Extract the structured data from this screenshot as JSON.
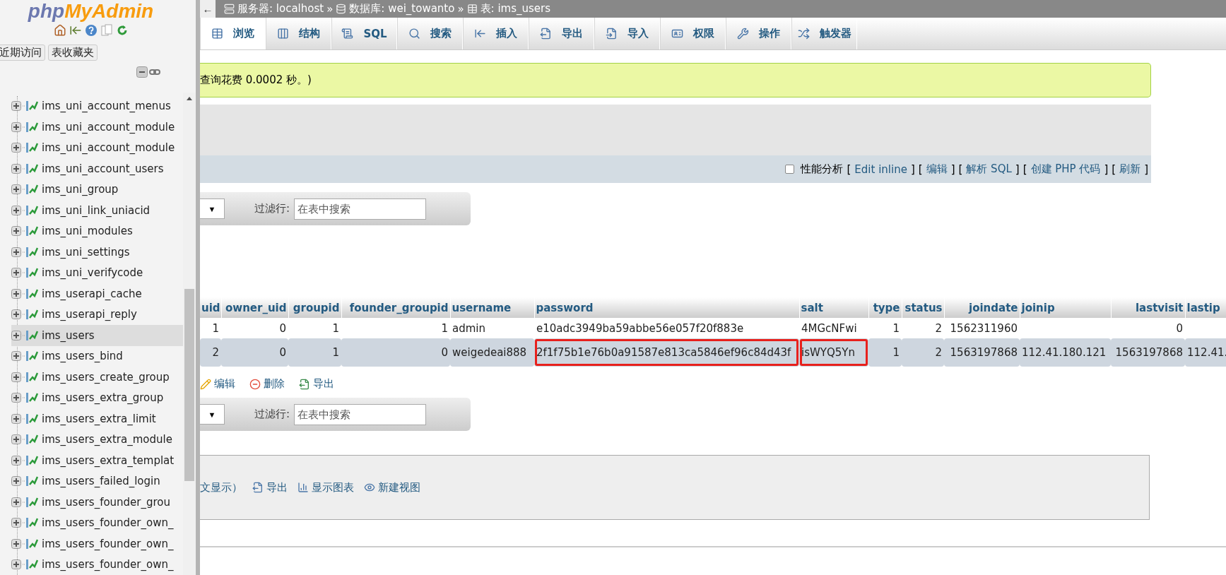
{
  "sidebar": {
    "logo": {
      "php": "php",
      "myadmin": "MyAdmin"
    },
    "buttons": [
      {
        "label": "近期访问"
      },
      {
        "label": "表收藏夹"
      }
    ],
    "tree": [
      {
        "label": "ims_uni_account_menus",
        "selected": false
      },
      {
        "label": "ims_uni_account_module",
        "selected": false
      },
      {
        "label": "ims_uni_account_module",
        "selected": false
      },
      {
        "label": "ims_uni_account_users",
        "selected": false
      },
      {
        "label": "ims_uni_group",
        "selected": false
      },
      {
        "label": "ims_uni_link_uniacid",
        "selected": false
      },
      {
        "label": "ims_uni_modules",
        "selected": false
      },
      {
        "label": "ims_uni_settings",
        "selected": false
      },
      {
        "label": "ims_uni_verifycode",
        "selected": false
      },
      {
        "label": "ims_userapi_cache",
        "selected": false
      },
      {
        "label": "ims_userapi_reply",
        "selected": false
      },
      {
        "label": "ims_users",
        "selected": true
      },
      {
        "label": "ims_users_bind",
        "selected": false
      },
      {
        "label": "ims_users_create_group",
        "selected": false
      },
      {
        "label": "ims_users_extra_group",
        "selected": false
      },
      {
        "label": "ims_users_extra_limit",
        "selected": false
      },
      {
        "label": "ims_users_extra_module",
        "selected": false
      },
      {
        "label": "ims_users_extra_templat",
        "selected": false
      },
      {
        "label": "ims_users_failed_login",
        "selected": false
      },
      {
        "label": "ims_users_founder_grou",
        "selected": false
      },
      {
        "label": "ims_users_founder_own_",
        "selected": false
      },
      {
        "label": "ims_users_founder_own_",
        "selected": false
      },
      {
        "label": "ims_users_founder_own_",
        "selected": false
      }
    ]
  },
  "breadcrumb": {
    "back": "←",
    "items": [
      {
        "label": "服务器: localhost",
        "separator": "»"
      },
      {
        "label": "数据库: wei_towanto",
        "separator": "»"
      },
      {
        "label": "表: ims_users"
      }
    ]
  },
  "tabs": [
    {
      "label": "浏览",
      "selected": true
    },
    {
      "label": "结构",
      "selected": false
    },
    {
      "label": "SQL",
      "selected": false
    },
    {
      "label": "搜索",
      "selected": false
    },
    {
      "label": "插入",
      "selected": false
    },
    {
      "label": "导出",
      "selected": false
    },
    {
      "label": "导入",
      "selected": false
    },
    {
      "label": "权限",
      "selected": false
    },
    {
      "label": "操作",
      "selected": false
    },
    {
      "label": "触发器",
      "selected": false
    }
  ],
  "notice": {
    "text": "查询花费 0.0002 秒。)"
  },
  "options_bar": {
    "profiling": {
      "label": "性能分析",
      "checked": false
    },
    "parts": [
      {
        "kind": "bracket",
        "text": "["
      },
      {
        "kind": "link",
        "text": "Edit inline"
      },
      {
        "kind": "bracket",
        "text": "]"
      },
      {
        "kind": "bracket",
        "text": "["
      },
      {
        "kind": "link",
        "text": "编辑"
      },
      {
        "kind": "bracket",
        "text": "]"
      },
      {
        "kind": "bracket",
        "text": "["
      },
      {
        "kind": "link",
        "text": "解析 SQL"
      },
      {
        "kind": "bracket",
        "text": "]"
      },
      {
        "kind": "bracket",
        "text": "["
      },
      {
        "kind": "link",
        "text": "创建 PHP 代码"
      },
      {
        "kind": "bracket",
        "text": "]"
      },
      {
        "kind": "bracket",
        "text": "["
      },
      {
        "kind": "link",
        "text": "刷新"
      },
      {
        "kind": "bracket",
        "text": "]"
      }
    ]
  },
  "filter_bars": [
    {
      "dropdown": "▼",
      "label": "过滤行:",
      "placeholder": "在表中搜索"
    },
    {
      "dropdown": "▼",
      "label": "过滤行:",
      "placeholder": "在表中搜索"
    }
  ],
  "table": {
    "columns": [
      {
        "label": "uid",
        "kind": "number"
      },
      {
        "label": "owner_uid",
        "kind": "number"
      },
      {
        "label": "groupid",
        "kind": "number"
      },
      {
        "label": "founder_groupid",
        "kind": "number"
      },
      {
        "label": "username",
        "kind": "text"
      },
      {
        "label": "password",
        "kind": "text"
      },
      {
        "label": "salt",
        "kind": "text"
      },
      {
        "label": "type",
        "kind": "number"
      },
      {
        "label": "status",
        "kind": "number"
      },
      {
        "label": "joindate",
        "kind": "number"
      },
      {
        "label": "joinip",
        "kind": "text"
      },
      {
        "label": "lastvisit",
        "kind": "number"
      },
      {
        "label": "lastip",
        "kind": "text"
      }
    ],
    "rows": [
      {
        "selected": false,
        "cells": [
          {
            "text": "1",
            "highlighted": false
          },
          {
            "text": "0",
            "highlighted": false
          },
          {
            "text": "1",
            "highlighted": false
          },
          {
            "text": "1",
            "highlighted": false
          },
          {
            "text": "admin",
            "highlighted": false
          },
          {
            "text": "e10adc3949ba59abbe56e057f20f883e",
            "highlighted": false
          },
          {
            "text": "4MGcNFwi",
            "highlighted": false
          },
          {
            "text": "1",
            "highlighted": false
          },
          {
            "text": "2",
            "highlighted": false
          },
          {
            "text": "1562311960",
            "highlighted": false
          },
          {
            "highlighted": false
          },
          {
            "text": "0",
            "highlighted": false
          },
          {
            "highlighted": false
          }
        ]
      },
      {
        "selected": true,
        "cells": [
          {
            "text": "2",
            "highlighted": false
          },
          {
            "text": "0",
            "highlighted": false
          },
          {
            "text": "1",
            "highlighted": false
          },
          {
            "text": "0",
            "highlighted": false
          },
          {
            "text": "weigedeai888",
            "highlighted": false
          },
          {
            "text": "2f1f75b1e76b0a91587e813ca5846ef96c84d43f",
            "highlighted": true
          },
          {
            "text": "isWYQ5Yn",
            "highlighted": true
          },
          {
            "text": "1",
            "highlighted": false
          },
          {
            "text": "2",
            "highlighted": false
          },
          {
            "text": "1563197868",
            "highlighted": false
          },
          {
            "text": "112.41.180.121",
            "highlighted": false
          },
          {
            "text": "1563197868",
            "highlighted": false
          },
          {
            "text": "112.41.",
            "highlighted": false
          }
        ]
      }
    ]
  },
  "row_actions": [
    {
      "label": "编辑"
    },
    {
      "label": "删除"
    },
    {
      "label": "导出"
    }
  ],
  "result_ops": {
    "text": "文显示）",
    "actions": [
      {
        "label": "导出"
      },
      {
        "label": "显示图表"
      },
      {
        "label": "新建视图"
      }
    ]
  }
}
